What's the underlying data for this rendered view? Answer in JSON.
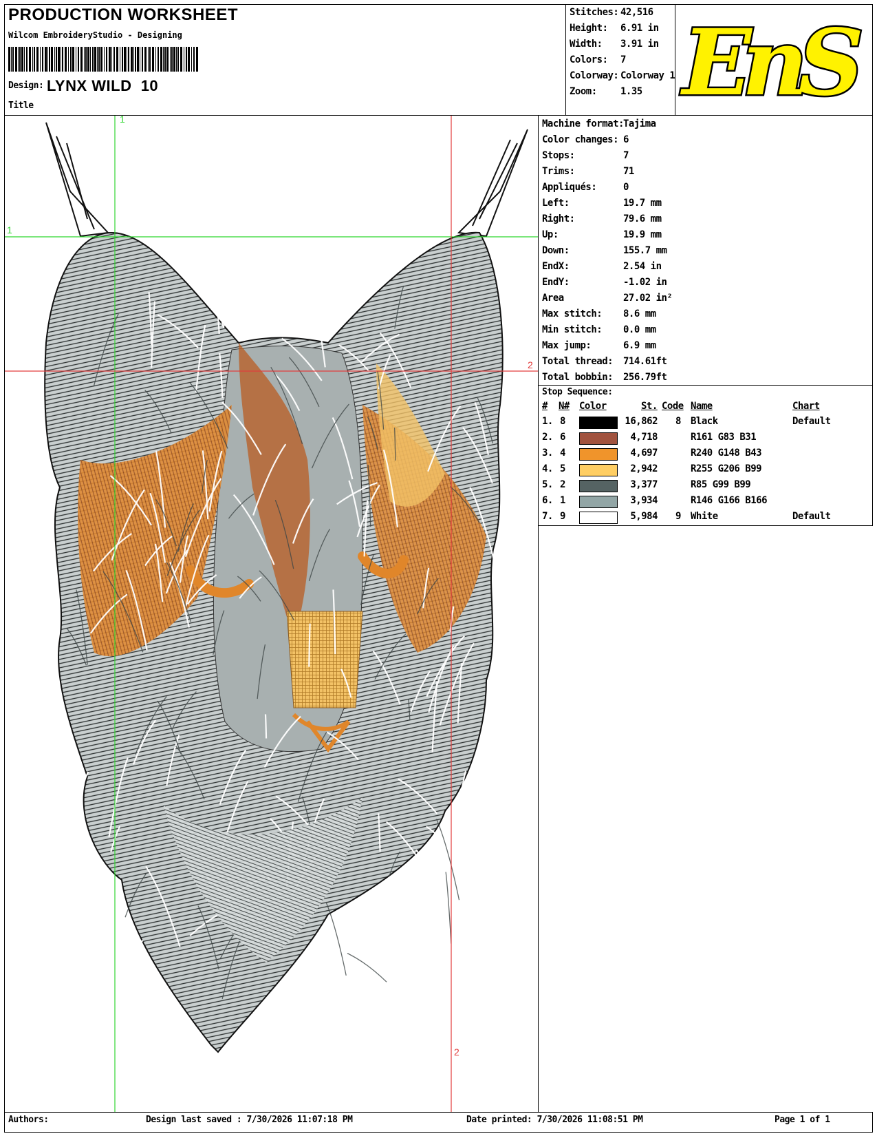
{
  "header": {
    "title": "PRODUCTION WORKSHEET",
    "software": "Wilcom EmbroideryStudio - Designing",
    "design_label": "Design:",
    "design_name": "LYNX WILD  10",
    "title_label": "Title"
  },
  "stats": [
    {
      "label": "Stitches:",
      "value": "42,516"
    },
    {
      "label": "Height:",
      "value": "6.91 in"
    },
    {
      "label": "Width:",
      "value": "3.91 in"
    },
    {
      "label": "Colors:",
      "value": "7"
    },
    {
      "label": "Colorway:",
      "value": "Colorway 1"
    },
    {
      "label": "Zoom:",
      "value": "1.35"
    }
  ],
  "logo": {
    "text": "EnS",
    "fill": "#fff200"
  },
  "machine": [
    {
      "label": "Machine format:",
      "value": "Tajima"
    },
    {
      "label": "Color changes:",
      "value": "6"
    },
    {
      "label": "Stops:",
      "value": "7"
    },
    {
      "label": "Trims:",
      "value": "71"
    },
    {
      "label": "Appliqués:",
      "value": "0"
    },
    {
      "label": "Left:",
      "value": "19.7 mm"
    },
    {
      "label": "Right:",
      "value": "79.6 mm"
    },
    {
      "label": "Up:",
      "value": "19.9 mm"
    },
    {
      "label": "Down:",
      "value": "155.7 mm"
    },
    {
      "label": "EndX:",
      "value": "2.54 in"
    },
    {
      "label": "EndY:",
      "value": "-1.02 in"
    },
    {
      "label": "Area",
      "value": "27.02 in²"
    },
    {
      "label": "Max stitch:",
      "value": "8.6 mm"
    },
    {
      "label": "Min stitch:",
      "value": "0.0 mm"
    },
    {
      "label": "Max jump:",
      "value": "6.9 mm"
    },
    {
      "label": "Total thread:",
      "value": "714.61ft"
    },
    {
      "label": "Total bobbin:",
      "value": "256.79ft"
    }
  ],
  "stop_sequence": {
    "title": "Stop Sequence:",
    "headers": {
      "num": "#",
      "n": "N#",
      "color": "Color",
      "st": "St.",
      "code": "Code",
      "name": "Name",
      "chart": "Chart"
    },
    "rows": [
      {
        "num": "1.",
        "n": "8",
        "color": "#000000",
        "st": "16,862",
        "code": "8",
        "name": "Black",
        "chart": "Default"
      },
      {
        "num": "2.",
        "n": "6",
        "color": "#a1533f",
        "st": "4,718",
        "code": "",
        "name": "R161 G83 B31",
        "chart": ""
      },
      {
        "num": "3.",
        "n": "4",
        "color": "#f0942b",
        "st": "4,697",
        "code": "",
        "name": "R240 G148 B43",
        "chart": ""
      },
      {
        "num": "4.",
        "n": "5",
        "color": "#ffce63",
        "st": "2,942",
        "code": "",
        "name": "R255 G206 B99",
        "chart": ""
      },
      {
        "num": "5.",
        "n": "2",
        "color": "#556363",
        "st": "3,377",
        "code": "",
        "name": "R85 G99 B99",
        "chart": ""
      },
      {
        "num": "6.",
        "n": "1",
        "color": "#92a6a6",
        "st": "3,934",
        "code": "",
        "name": "R146 G166 B166",
        "chart": ""
      },
      {
        "num": "7.",
        "n": "9",
        "color": "#ffffff",
        "st": "5,984",
        "code": "9",
        "name": "White",
        "chart": "Default"
      }
    ]
  },
  "guides": {
    "v1": "1",
    "h1": "1",
    "h2": "2",
    "v2": "2"
  },
  "footer": {
    "authors_label": "Authors:",
    "saved": "Design last saved : 7/30/2026 11:07:18 PM",
    "printed": "Date printed: 7/30/2026 11:08:51 PM",
    "page": "Page 1 of 1"
  }
}
